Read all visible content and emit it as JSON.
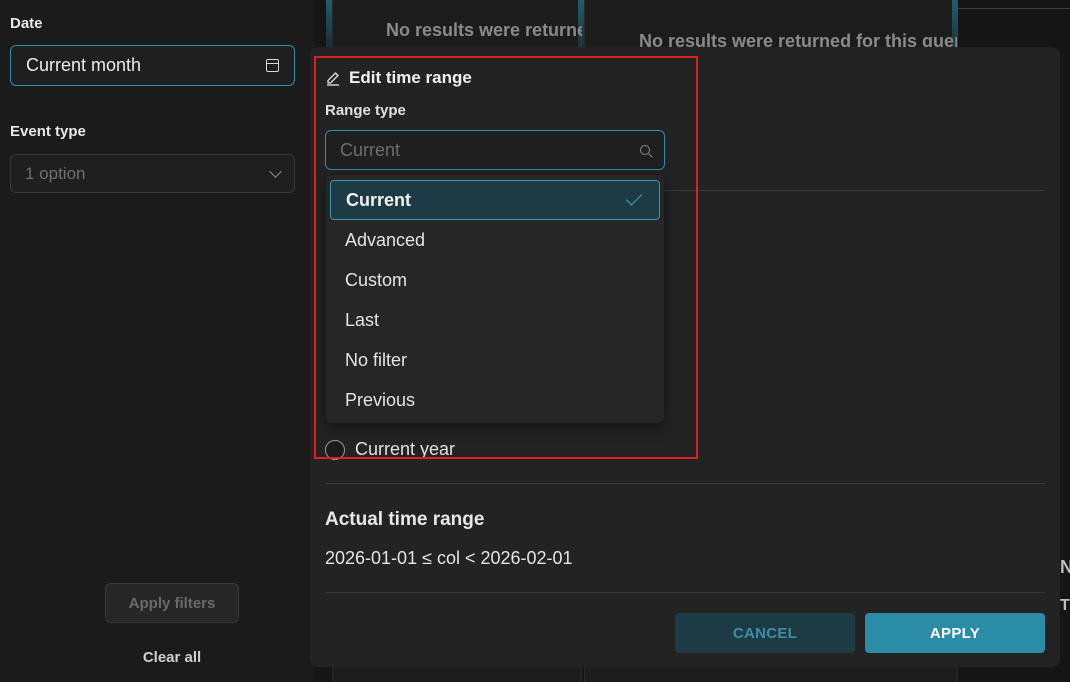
{
  "filters": {
    "date_label": "Date",
    "date_value": "Current month",
    "event_type_label": "Event type",
    "event_type_value": "1 option",
    "apply_filters_label": "Apply filters",
    "clear_all_label": "Clear all"
  },
  "background": {
    "no_results_1": "No results were returne",
    "no_results_2": "No results were returned for this quer",
    "edge_text_1": "N",
    "edge_text_2": "T"
  },
  "modal": {
    "title": "Edit time range",
    "range_type_label": "Range type",
    "search_placeholder": "Current",
    "options": [
      {
        "label": "Current",
        "selected": true
      },
      {
        "label": "Advanced",
        "selected": false
      },
      {
        "label": "Custom",
        "selected": false
      },
      {
        "label": "Last",
        "selected": false
      },
      {
        "label": "No filter",
        "selected": false
      },
      {
        "label": "Previous",
        "selected": false
      }
    ],
    "radio_option": "Current year",
    "actual_range_title": "Actual time range",
    "actual_range_value": "2026-01-01 ≤ col < 2026-02-01",
    "cancel_label": "CANCEL",
    "apply_label": "APPLY"
  },
  "colors": {
    "accent": "#2b8ca7",
    "highlight": "#e02020",
    "panel": "#232323"
  }
}
